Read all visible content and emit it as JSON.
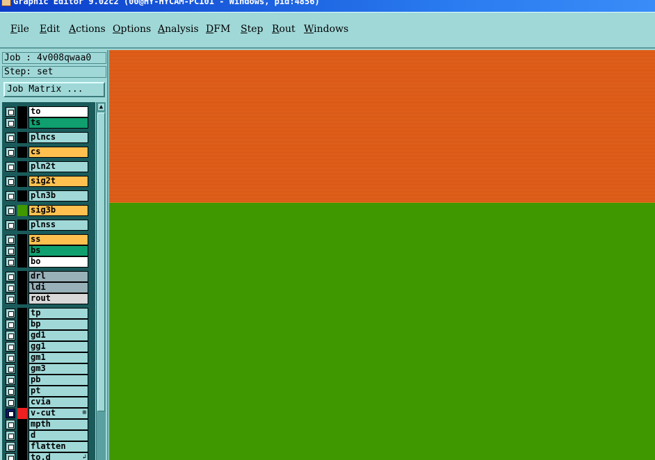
{
  "window": {
    "title": "Graphic Editor 9.02c2 (00@HY-HYCAM-PC101 - Windows, pid:4856)"
  },
  "menu": [
    {
      "label": "File",
      "name": "menu-file"
    },
    {
      "label": "Edit",
      "name": "menu-edit"
    },
    {
      "label": "Actions",
      "name": "menu-actions"
    },
    {
      "label": "Options",
      "name": "menu-options"
    },
    {
      "label": "Analysis",
      "name": "menu-analysis"
    },
    {
      "label": "DFM",
      "name": "menu-dfm"
    },
    {
      "label": "Step",
      "name": "menu-step"
    },
    {
      "label": "Rout",
      "name": "menu-rout"
    },
    {
      "label": "Windows",
      "name": "menu-windows"
    }
  ],
  "job_info": {
    "job": "Job : 4v008qwaa0",
    "step": "Step: set",
    "job_matrix_button": "Job Matrix ..."
  },
  "colors": {
    "layer_board_top": "#e05a14",
    "layer_board_bottom": "#409800",
    "selected_row_color": "#ee2020"
  },
  "layers": [
    {
      "name": "to",
      "bg": "#ffffff",
      "color": "#000000"
    },
    {
      "name": "ts",
      "bg": "#10a070",
      "color": "#000000"
    },
    {
      "name": "plncs",
      "bg": "#a0d8d8",
      "color": "#000000"
    },
    {
      "name": "cs",
      "bg": "#ffc050",
      "color": "#000000"
    },
    {
      "name": "pln2t",
      "bg": "#a0d8d8",
      "color": "#000000"
    },
    {
      "name": "sig2t",
      "bg": "#ffc050",
      "color": "#000000"
    },
    {
      "name": "pln3b",
      "bg": "#a0d8d8",
      "color": "#000000"
    },
    {
      "name": "sig3b",
      "bg": "#ffc050",
      "color": "#409800"
    },
    {
      "name": "plnss",
      "bg": "#a0d8d8",
      "color": "#000000"
    },
    {
      "name": "ss",
      "bg": "#ffc050",
      "color": "#000000"
    },
    {
      "name": "bs",
      "bg": "#10a070",
      "color": "#000000"
    },
    {
      "name": "bo",
      "bg": "#ffffff",
      "color": "#000000"
    },
    {
      "name": "drl",
      "bg": "#98b0b8",
      "color": "#000000"
    },
    {
      "name": "ldi",
      "bg": "#98b0b8",
      "color": "#000000"
    },
    {
      "name": "rout",
      "bg": "#d8d8d8",
      "color": "#000000"
    },
    {
      "name": "tp",
      "bg": "#a0d8d8",
      "color": "#000000"
    },
    {
      "name": "bp",
      "bg": "#a0d8d8",
      "color": "#000000"
    },
    {
      "name": "gd1",
      "bg": "#a0d8d8",
      "color": "#000000"
    },
    {
      "name": "gg1",
      "bg": "#a0d8d8",
      "color": "#000000"
    },
    {
      "name": "gm1",
      "bg": "#a0d8d8",
      "color": "#000000"
    },
    {
      "name": "gm3",
      "bg": "#a0d8d8",
      "color": "#000000"
    },
    {
      "name": "pb",
      "bg": "#a0d8d8",
      "color": "#000000"
    },
    {
      "name": "pt",
      "bg": "#a0d8d8",
      "color": "#000000"
    },
    {
      "name": "cvia",
      "bg": "#a0d8d8",
      "color": "#000000"
    },
    {
      "name": "v-cut",
      "bg": "#a0d8d8",
      "color": "#ee2020",
      "active": true,
      "tag": "⊞"
    },
    {
      "name": "mpth",
      "bg": "#a0d8d8",
      "color": "#000000"
    },
    {
      "name": "d",
      "bg": "#a0d8d8",
      "color": "#000000"
    },
    {
      "name": "flatten",
      "bg": "#a0d8d8",
      "color": "#000000"
    },
    {
      "name": "to.d",
      "bg": "#a0d8d8",
      "color": "#000000",
      "tag": "↲"
    }
  ]
}
